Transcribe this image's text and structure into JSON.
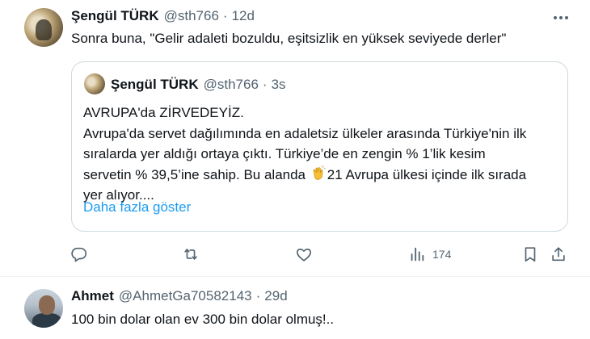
{
  "tweet_main": {
    "name": "Şengül TÜRK",
    "handle": "@sth766",
    "time": "12d",
    "text": "Sonra buna, \"Gelir adaleti bozuldu, eşitsizlik en yüksek seviyede derler\""
  },
  "quoted_tweet": {
    "name": "Şengül TÜRK",
    "handle": "@sth766",
    "time": "3s",
    "line1": "AVRUPA'da ZİRVEDEYİZ.",
    "line2": "Avrupa'da servet dağılımında en adaletsiz ülkeler arasında Türkiye'nin ilk",
    "line3": "sıralarda yer aldığı ortaya çıktı. Türkiye’de en zengin % 1’lik kesim",
    "line4_before": "servetin % 39,5’ine sahip. Bu alanda ",
    "line4_after": "21 Avrupa ülkesi içinde ilk sırada",
    "line5": "yer alıyor....",
    "emoji": "clapping-hands",
    "show_more": "Daha fazla göster"
  },
  "actions": {
    "reply_icon": "reply-icon",
    "retweet_icon": "retweet-icon",
    "like_icon": "like-icon",
    "views_icon": "views-icon",
    "views_count": "174",
    "bookmark_icon": "bookmark-icon",
    "share_icon": "share-icon"
  },
  "reply_tweet": {
    "name": "Ahmet",
    "handle": "@AhmetGa70582143",
    "time": "29d",
    "text": "100 bin dolar olan ev 300 bin dolar olmuş!.."
  },
  "colors": {
    "text": "#0f1419",
    "secondary": "#536471",
    "link": "#1d9bf0",
    "border": "#cfd9de"
  }
}
